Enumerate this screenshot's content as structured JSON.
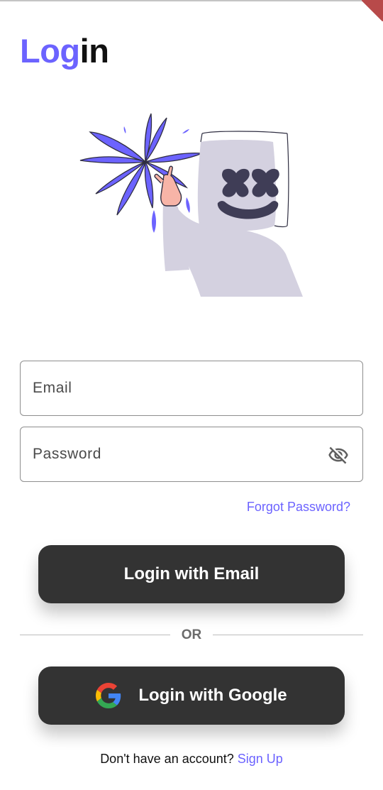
{
  "header": {
    "title_accent": "Log",
    "title_rest": "in"
  },
  "form": {
    "email_placeholder": "Email",
    "password_placeholder": "Password",
    "forgot_password": "Forgot Password?"
  },
  "actions": {
    "login_email": "Login with Email",
    "divider": "OR",
    "login_google": "Login with Google"
  },
  "footer": {
    "prompt": "Don't have an account? ",
    "signup": "Sign Up"
  },
  "icons": {
    "password_toggle": "eye-off-icon",
    "google": "google-logo-icon"
  },
  "colors": {
    "accent": "#6c63ff",
    "button": "#333333",
    "illustration_body": "#d4d1e0",
    "mask_features": "#3f3d56"
  }
}
